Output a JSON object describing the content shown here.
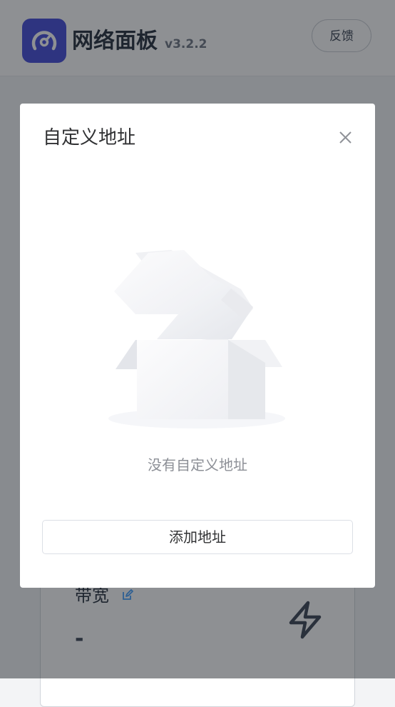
{
  "header": {
    "app_title": "网络面板",
    "version": "v3.2.2",
    "feedback_label": "反馈"
  },
  "background_card": {
    "title": "带宽",
    "value": "-"
  },
  "modal": {
    "title": "自定义地址",
    "empty_text": "没有自定义地址",
    "add_button_label": "添加地址"
  },
  "icons": {
    "logo": "speedometer-icon",
    "close": "close-icon",
    "edit": "edit-icon",
    "bolt": "lightning-bolt-icon",
    "empty": "empty-box-illustration"
  },
  "colors": {
    "brand": "#3f46d8",
    "link": "#409eff",
    "overlay": "rgba(30,33,40,0.5)"
  }
}
